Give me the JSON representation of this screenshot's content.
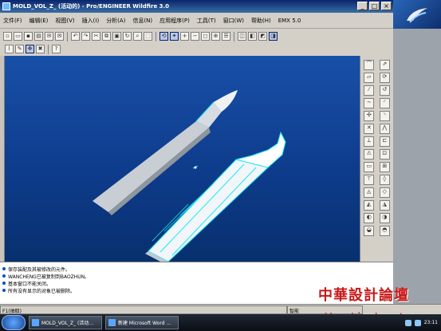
{
  "window": {
    "title": "MOLD_VOL_Z_ (活动的) - Pro/ENGINEER Wildfire 3.0"
  },
  "menu": [
    "文件(F)",
    "编辑(E)",
    "视图(V)",
    "插入(I)",
    "分析(A)",
    "信息(N)",
    "应用程序(P)",
    "工具(T)",
    "窗口(W)",
    "帮助(H)",
    "EMX 5.0"
  ],
  "toolbar1": {
    "icons": [
      "new-file",
      "open-folder",
      "save",
      "print",
      "email",
      "email-link",
      "undo",
      "redo",
      "cut",
      "copy",
      "paste",
      "regenerate",
      "find",
      "select-box",
      "repaint",
      "spin-center",
      "zoom-in",
      "zoom-out",
      "refit",
      "orient",
      "view-list",
      "display-style",
      "layers",
      "datum-planes",
      "datum-axes",
      "datum-points",
      "datum-csys"
    ]
  },
  "toolbar2": {
    "icons": [
      "sketch",
      "pencil",
      "edit",
      "pattern",
      "context-help"
    ]
  },
  "sidebar": {
    "icons": [
      "datum-plane",
      "datum-axis",
      "datum-curve",
      "datum-point",
      "csys",
      "sketched-curve",
      "extrude",
      "revolve",
      "sweep",
      "blend",
      "round",
      "chamfer",
      "hole",
      "shell",
      "rib",
      "draft",
      "mirror",
      "merge",
      "trim",
      "offset",
      "thicken",
      "solidify",
      "parting-surface",
      "mold-volume",
      "split",
      "cut-out",
      "copy-surface",
      "fill",
      "extend",
      "intersect"
    ]
  },
  "messages": [
    "保存装配及其被修改的元件。",
    "WANCHENG已被复制到BAOZHUN。",
    "基本窗口不能关闭。",
    "所有没有显示的对象已被删除。"
  ],
  "status": {
    "left": "F1(抽取)",
    "mode": "智能"
  },
  "taskbar": {
    "items": [
      "MOLD_VOL_Z_ (活动...",
      "新建 Microsoft Word ..."
    ],
    "clock": "23:11"
  },
  "watermark": {
    "line1": "中華設計論壇",
    "line2": "bbs.chinade.net"
  },
  "colors": {
    "viewport_top": "#1850a8",
    "viewport_bottom": "#08306e",
    "part_gray": "#b4bcc4",
    "part_white": "#f2f6f8",
    "edge_cyan": "#18e8f8"
  }
}
